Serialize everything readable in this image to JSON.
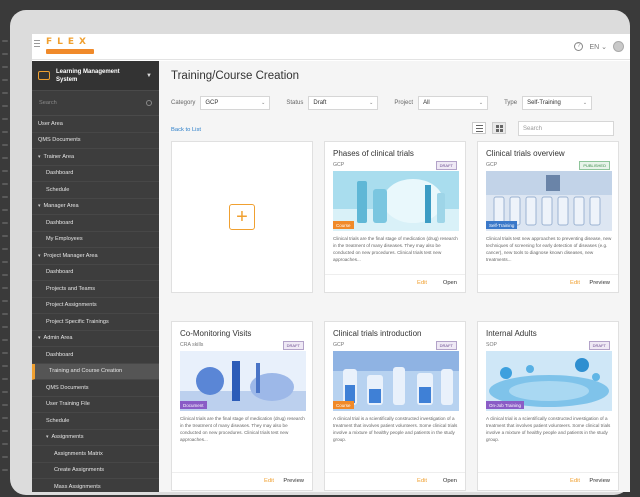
{
  "app": {
    "logo_text": "FLEX",
    "lang": "EN"
  },
  "sidebar": {
    "title": "Learning Management System",
    "search_placeholder": "Search",
    "items": [
      {
        "label": "User Area",
        "level": 0
      },
      {
        "label": "QMS Documents",
        "level": 0
      },
      {
        "label": "Trainer Area",
        "level": 0,
        "caret": "v"
      },
      {
        "label": "Dashboard",
        "level": 1
      },
      {
        "label": "Schedule",
        "level": 1
      },
      {
        "label": "Manager Area",
        "level": 0,
        "caret": "v"
      },
      {
        "label": "Dashboard",
        "level": 1
      },
      {
        "label": "My Employees",
        "level": 1
      },
      {
        "label": "Project Manager Area",
        "level": 0,
        "caret": "v"
      },
      {
        "label": "Dashboard",
        "level": 1
      },
      {
        "label": "Projects and Teams",
        "level": 1
      },
      {
        "label": "Project Assignments",
        "level": 1
      },
      {
        "label": "Project Specific Trainings",
        "level": 1
      },
      {
        "label": "Admin Area",
        "level": 0,
        "caret": "v"
      },
      {
        "label": "Dashboard",
        "level": 1
      },
      {
        "label": "Training and Course Creation",
        "level": 1,
        "active": true
      },
      {
        "label": "QMS Documents",
        "level": 1
      },
      {
        "label": "User Training File",
        "level": 1
      },
      {
        "label": "Schedule",
        "level": 1
      },
      {
        "label": "Assignments",
        "level": 1,
        "caret": "v"
      },
      {
        "label": "Assignments Matrix",
        "level": 2
      },
      {
        "label": "Create Assignments",
        "level": 2
      },
      {
        "label": "Mass Assignments",
        "level": 2
      }
    ]
  },
  "main": {
    "title": "Training/Course Creation",
    "back_link": "Back to List",
    "search_placeholder": "Search",
    "filters": [
      {
        "label": "Category",
        "value": "GCP"
      },
      {
        "label": "Status",
        "value": "Draft"
      },
      {
        "label": "Project",
        "value": "All"
      },
      {
        "label": "Type",
        "value": "Self-Training"
      }
    ],
    "cards": [
      {
        "title": "Phases of clinical trials",
        "sub": "GCP",
        "status": "DRAFT",
        "tag": "Course",
        "tag_color": "#f08a2a",
        "desc": "Clinical trials are the final stage of medication (drug) research in the treatment of many diseases. They may also be conducted on new procedures. Clinical trials test new approaches...",
        "edit": "Edit",
        "action": "Open"
      },
      {
        "title": "Clinical trials overview",
        "sub": "GCP",
        "status": "PUBLISHED",
        "tag": "Self-Training",
        "tag_color": "#3a78c9",
        "desc": "Clinical trials test new approaches to preventing disease, new techniques of screening for early detection of diseases (e.g. cancer), new tools to diagnose known diseases, new treatments...",
        "edit": "Edit",
        "action": "Preview"
      },
      {
        "title": "Co-Monitoring Visits",
        "sub": "CRA skills",
        "status": "DRAFT",
        "tag": "Document",
        "tag_color": "#8a5cc6",
        "desc": "Clinical trials are the final stage of medication (drug) research in the treatment of many diseases. They may also be conducted on new procedures. Clinical trials test new approaches...",
        "edit": "Edit",
        "action": "Preview"
      },
      {
        "title": "Clinical trials introduction",
        "sub": "GCP",
        "status": "DRAFT",
        "tag": "Course",
        "tag_color": "#f08a2a",
        "desc": "A clinical trial is a scientifically constructed investigation of a treatment that involves patient volunteers. Some clinical trials involve a mixture of healthy people and patients in the study group.",
        "edit": "Edit",
        "action": "Open"
      },
      {
        "title": "Internal Adults",
        "sub": "SOP",
        "status": "DRAFT",
        "tag": "On-Job Training",
        "tag_color": "#8a5cc6",
        "desc": "A clinical trial is a scientifically constructed investigation of a treatment that involves patient volunteers. Some clinical trials involve a mixture of healthy people and patients in the study group.",
        "edit": "Edit",
        "action": "Preview"
      }
    ]
  },
  "colors": {
    "accent": "#f0a030",
    "sidebar": "#3d3d3d",
    "link": "#2a7ec9"
  }
}
